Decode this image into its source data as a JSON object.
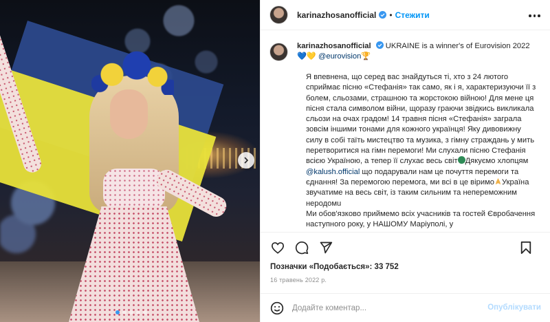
{
  "post": {
    "username": "karinazhosanofficial",
    "follow_label": "Стежити",
    "separator": "•",
    "photo_alt_icons": [
      "next-arrow-icon"
    ],
    "carousel": {
      "count": 5,
      "active_index": 0
    }
  },
  "caption": {
    "username": "karinazhosanofficial",
    "headline": " UKRAINE is a winner's of Eurovision 2022",
    "hearts": "💙💛",
    "mention_eurovision": "@eurovision",
    "trophy": "🏆",
    "p1": "Я впевнена, що серед вас знайдуться ті, хто з 24 лютого сприймає пісню «Стефанія» так само, як і я, характеризуючи її з болем, сльозами, страшною та жорстокою війною! Для мене ця пісня стала символом війни, щоразу граючи звідкись викликала сльози на очах градом! 14 травня пісня «Стефанія» заграла зовсім іншими тонами для кожного українця! Яку дивовижну силу в собі таїть мистецтво та музика, з гімну страждань у мить перетворитися на гімн перемоги! Ми слухали пісню Стефанія всією Україною, а тепер її слухає весь світ",
    "p2a": "Дякуємо хлопцям ",
    "mention_kalush": "@kalush.official",
    "p2b": " що подарували нам це почуття перемоги та єднання! За перемогою перемога, ми всі в це віримо",
    "p2c": "Україна звучатиме на весь світ, із таким сильним та непереможним неродомu",
    "p3": "Ми обов'язково приймемо всіх учасників та гостей Євробачення наступного року, у НАШОМУ Маріуполі, у"
  },
  "footer": {
    "likes": "Позначки «Подобається»: 33 752",
    "date": "16 травень 2022 р.",
    "comment_placeholder": "Додайте коментар...",
    "publish_label": "Опублікувати"
  },
  "colors": {
    "accent": "#0095f6",
    "verified": "#3897f0",
    "publish_disabled": "#b3dbff"
  }
}
